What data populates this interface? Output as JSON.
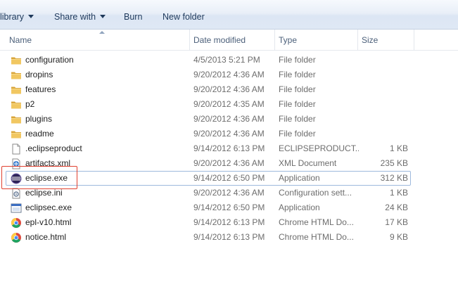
{
  "toolbar": {
    "library_label": "library",
    "share_label": "Share with",
    "burn_label": "Burn",
    "new_folder_label": "New folder"
  },
  "columns": {
    "name": "Name",
    "date": "Date modified",
    "type": "Type",
    "size": "Size"
  },
  "icons": {
    "folder": "folder-icon",
    "file": "file-icon",
    "xml": "xml-file-icon",
    "eclipse": "eclipse-icon",
    "ini": "settings-file-icon",
    "exe": "application-icon",
    "chrome": "chrome-html-icon"
  },
  "colors": {
    "highlight": "#e0402f",
    "selection_border": "#9eb9dd",
    "folder": "#e8b84a"
  },
  "files": [
    {
      "name": "configuration",
      "date": "4/5/2013 5:21 PM",
      "type": "File folder",
      "size": "",
      "icon": "folder"
    },
    {
      "name": "dropins",
      "date": "9/20/2012 4:36 AM",
      "type": "File folder",
      "size": "",
      "icon": "folder"
    },
    {
      "name": "features",
      "date": "9/20/2012 4:36 AM",
      "type": "File folder",
      "size": "",
      "icon": "folder"
    },
    {
      "name": "p2",
      "date": "9/20/2012 4:35 AM",
      "type": "File folder",
      "size": "",
      "icon": "folder"
    },
    {
      "name": "plugins",
      "date": "9/20/2012 4:36 AM",
      "type": "File folder",
      "size": "",
      "icon": "folder"
    },
    {
      "name": "readme",
      "date": "9/20/2012 4:36 AM",
      "type": "File folder",
      "size": "",
      "icon": "folder"
    },
    {
      "name": ".eclipseproduct",
      "date": "9/14/2012 6:13 PM",
      "type": "ECLIPSEPRODUCT...",
      "size": "1 KB",
      "icon": "file"
    },
    {
      "name": "artifacts.xml",
      "date": "9/20/2012 4:36 AM",
      "type": "XML Document",
      "size": "235 KB",
      "icon": "xml"
    },
    {
      "name": "eclipse.exe",
      "date": "9/14/2012 6:50 PM",
      "type": "Application",
      "size": "312 KB",
      "icon": "eclipse"
    },
    {
      "name": "eclipse.ini",
      "date": "9/20/2012 4:36 AM",
      "type": "Configuration sett...",
      "size": "1 KB",
      "icon": "ini"
    },
    {
      "name": "eclipsec.exe",
      "date": "9/14/2012 6:50 PM",
      "type": "Application",
      "size": "24 KB",
      "icon": "exe"
    },
    {
      "name": "epl-v10.html",
      "date": "9/14/2012 6:13 PM",
      "type": "Chrome HTML Do...",
      "size": "17 KB",
      "icon": "chrome"
    },
    {
      "name": "notice.html",
      "date": "9/14/2012 6:13 PM",
      "type": "Chrome HTML Do...",
      "size": "9 KB",
      "icon": "chrome"
    }
  ]
}
